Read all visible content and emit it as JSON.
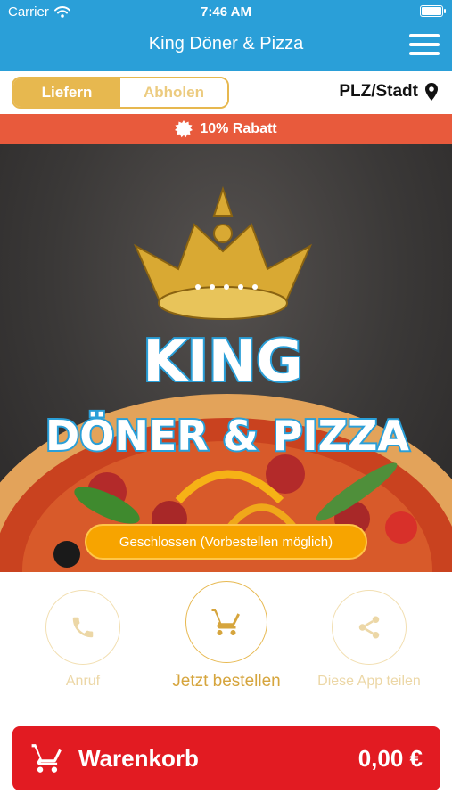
{
  "status_bar": {
    "carrier": "Carrier",
    "time": "7:46 AM"
  },
  "header": {
    "title": "King Döner & Pizza",
    "menu_icon": "hamburger-menu-icon"
  },
  "order_mode": {
    "options": [
      "Liefern",
      "Abholen"
    ],
    "selected": "Liefern",
    "location_label": "PLZ/Stadt",
    "location_icon": "map-pin-icon"
  },
  "discount": {
    "label": "10% Rabatt",
    "icon": "badge-icon",
    "color": "#e85a3c"
  },
  "hero": {
    "logo_line1": "KING",
    "logo_line2": "DÖNER & PIZZA",
    "status": "Geschlossen (Vorbestellen möglich)"
  },
  "actions": [
    {
      "label": "Anruf",
      "icon": "phone-icon"
    },
    {
      "label": "Jetzt bestellen",
      "icon": "cart-icon"
    },
    {
      "label": "Diese App teilen",
      "icon": "share-icon"
    }
  ],
  "cart": {
    "label": "Warenkorb",
    "total": "0,00 €",
    "icon": "cart-icon"
  },
  "colors": {
    "header": "#2a9fd8",
    "accent": "#e7b84f",
    "cart": "#e21b22",
    "status_pill": "#f7a400"
  }
}
